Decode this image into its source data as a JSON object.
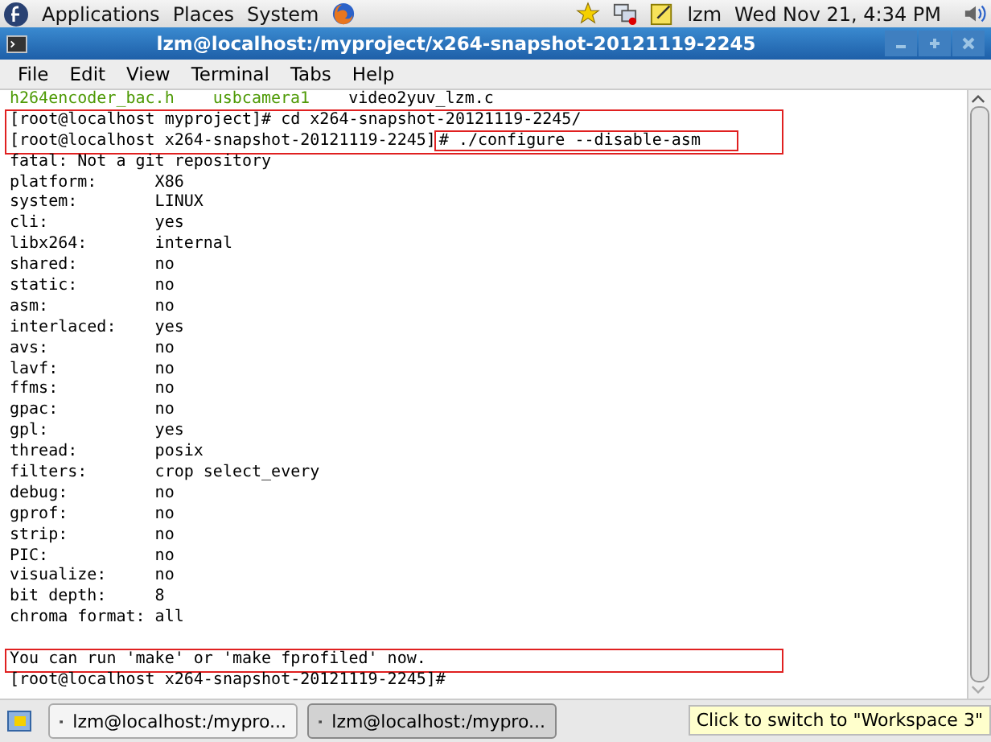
{
  "top_panel": {
    "menus": [
      "Applications",
      "Places",
      "System"
    ],
    "user": "lzm",
    "clock": "Wed Nov 21,  4:34 PM"
  },
  "window": {
    "title": "lzm@localhost:/myproject/x264-snapshot-20121119-2245"
  },
  "menu_bar": [
    "File",
    "Edit",
    "View",
    "Terminal",
    "Tabs",
    "Help"
  ],
  "terminal": {
    "blocks": [
      {
        "boxed": false,
        "lines": [
          {
            "kind": "files",
            "files": [
              {
                "name": "h264encoder_bac.h",
                "color": "#4e9a06"
              },
              {
                "name": "usbcamera1",
                "color": "#4e9a06"
              },
              {
                "name": "video2yuv_lzm.c",
                "color": "#000000"
              }
            ]
          }
        ]
      },
      {
        "boxed": true,
        "lines": [
          {
            "kind": "prompt",
            "prompt": "[root@localhost myproject]",
            "command": "# cd x264-snapshot-20121119-2245/",
            "command_boxed": false
          },
          {
            "kind": "prompt",
            "prompt": "[root@localhost x264-snapshot-20121119-2245]",
            "command": "# ./configure --disable-asm",
            "command_boxed": true
          }
        ]
      },
      {
        "boxed": false,
        "lines": [
          {
            "kind": "text",
            "text": "fatal: Not a git repository"
          },
          {
            "kind": "kv",
            "key": "platform:",
            "value": "X86"
          },
          {
            "kind": "kv",
            "key": "system:",
            "value": "LINUX"
          },
          {
            "kind": "kv",
            "key": "cli:",
            "value": "yes"
          },
          {
            "kind": "kv",
            "key": "libx264:",
            "value": "internal"
          },
          {
            "kind": "kv",
            "key": "shared:",
            "value": "no"
          },
          {
            "kind": "kv",
            "key": "static:",
            "value": "no"
          },
          {
            "kind": "kv",
            "key": "asm:",
            "value": "no"
          },
          {
            "kind": "kv",
            "key": "interlaced:",
            "value": "yes"
          },
          {
            "kind": "kv",
            "key": "avs:",
            "value": "no"
          },
          {
            "kind": "kv",
            "key": "lavf:",
            "value": "no"
          },
          {
            "kind": "kv",
            "key": "ffms:",
            "value": "no"
          },
          {
            "kind": "kv",
            "key": "gpac:",
            "value": "no"
          },
          {
            "kind": "kv",
            "key": "gpl:",
            "value": "yes"
          },
          {
            "kind": "kv",
            "key": "thread:",
            "value": "posix"
          },
          {
            "kind": "kv",
            "key": "filters:",
            "value": "crop select_every"
          },
          {
            "kind": "kv",
            "key": "debug:",
            "value": "no"
          },
          {
            "kind": "kv",
            "key": "gprof:",
            "value": "no"
          },
          {
            "kind": "kv",
            "key": "strip:",
            "value": "no"
          },
          {
            "kind": "kv",
            "key": "PIC:",
            "value": "no"
          },
          {
            "kind": "kv",
            "key": "visualize:",
            "value": "no"
          },
          {
            "kind": "kv",
            "key": "bit depth:",
            "value": "8"
          },
          {
            "kind": "kv",
            "key": "chroma format:",
            "value": "all"
          },
          {
            "kind": "blank"
          }
        ]
      },
      {
        "boxed": true,
        "lines": [
          {
            "kind": "text",
            "text": "You can run 'make' or 'make fprofiled' now."
          }
        ]
      },
      {
        "boxed": false,
        "lines": [
          {
            "kind": "prompt",
            "prompt": "[root@localhost x264-snapshot-20121119-2245]",
            "command": "#",
            "command_boxed": false
          }
        ]
      }
    ]
  },
  "taskbar": {
    "windows": [
      {
        "label": "lzm@localhost:/mypro...",
        "selected": false
      },
      {
        "label": "lzm@localhost:/mypro...",
        "selected": true
      }
    ],
    "tooltip": "Click to switch to \"Workspace 3\""
  }
}
